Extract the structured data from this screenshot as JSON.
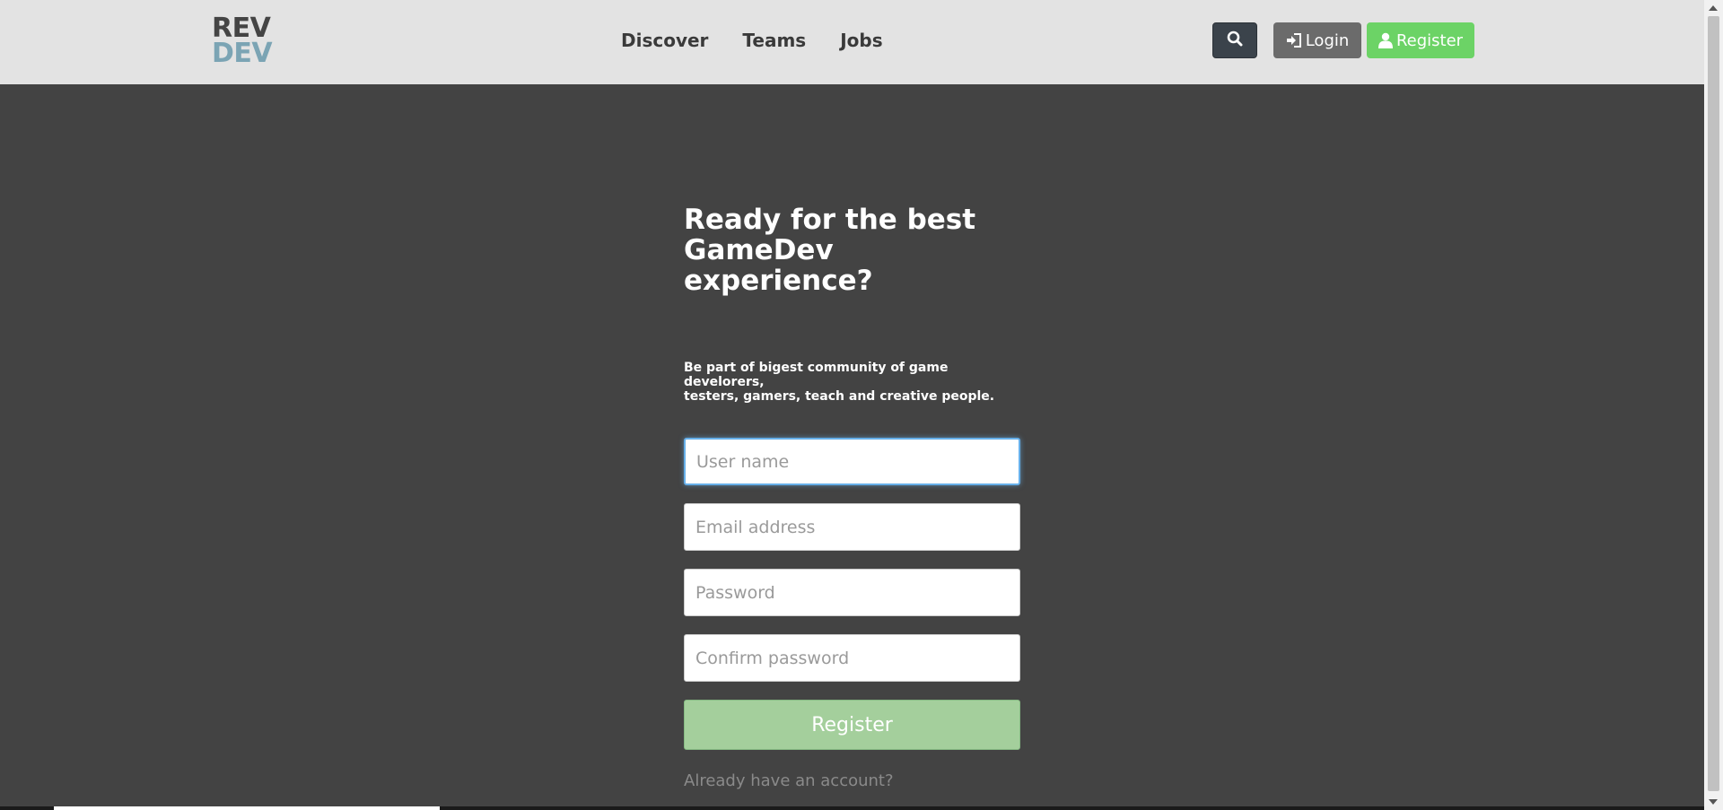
{
  "header": {
    "logo_line1": "REV",
    "logo_line2": "DEV",
    "nav": [
      {
        "label": "Discover"
      },
      {
        "label": "Teams"
      },
      {
        "label": "Jobs"
      }
    ],
    "login_label": "Login",
    "register_label": "Register"
  },
  "main": {
    "headline_line1": "Ready for the best",
    "headline_line2": "GameDev experience?",
    "subtitle_line1": "Be part of bigest community of game develorers,",
    "subtitle_line2": "testers, gamers, teach and creative people.",
    "username_placeholder": "User name",
    "email_placeholder": "Email address",
    "password_placeholder": "Password",
    "confirm_placeholder": "Confirm password",
    "submit_label": "Register",
    "account_link": "Already have an account?"
  },
  "icons": {
    "search": "search-icon",
    "login": "sign-in-icon",
    "register": "user-icon"
  },
  "colors": {
    "background": "#434343",
    "navbar": "#e3e3e3",
    "register_green": "#6cd366",
    "submit_green": "#a4cf9c",
    "logo_dev": "#7ba4b4"
  }
}
